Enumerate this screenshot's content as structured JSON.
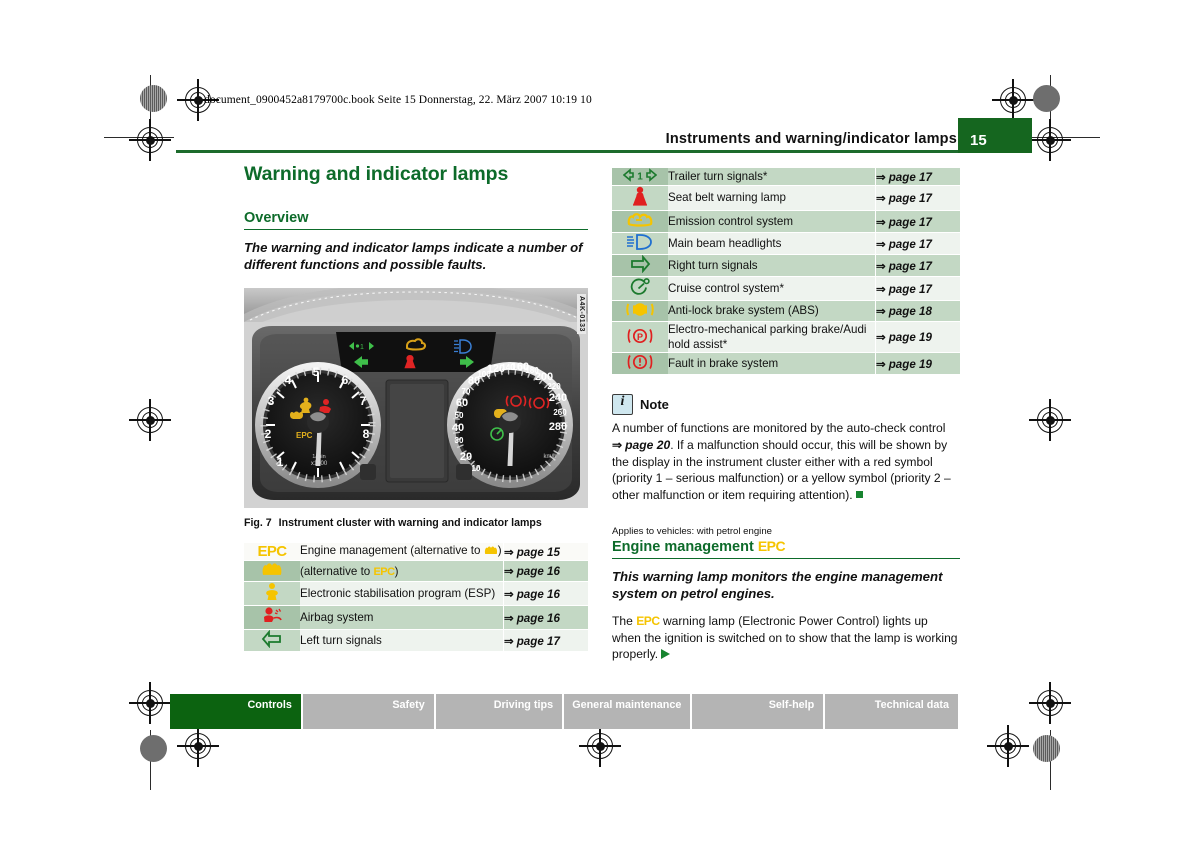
{
  "document_meta": "document_0900452a8179700c.book  Seite 15  Donnerstag, 22. März 2007  10:19 10",
  "header": {
    "title": "Instruments and warning/indicator lamps",
    "page_number": "15",
    "accent_color": "#15661f"
  },
  "left_column": {
    "chapter_title": "Warning and indicator lamps",
    "section_title": "Overview",
    "lead": "The warning and indicator lamps indicate a number of different functions and possible faults.",
    "figure": {
      "code": "A4K-0133",
      "caption_label": "Fig. 7",
      "caption_text": "Instrument cluster with warning and indicator lamps",
      "tachometer": {
        "ticks": [
          "1",
          "2",
          "3",
          "4",
          "5",
          "6",
          "7",
          "8"
        ],
        "unit": "1/min x1000"
      },
      "speedometer": {
        "ticks": [
          "10",
          "20",
          "30",
          "40",
          "50",
          "60",
          "70",
          "80",
          "100",
          "120",
          "140",
          "160",
          "180",
          "200",
          "220",
          "240",
          "260",
          "280"
        ],
        "unit": "km/h"
      }
    },
    "table_rows": [
      {
        "icon": "epc-lamp",
        "icon_color": "#f5c400",
        "desc_pre": "Engine management (alternative to ",
        "desc_post": ")",
        "desc_inline_icon": "glow-plug-lamp",
        "ref": "page 15",
        "shade": "white"
      },
      {
        "icon": "glow-plug-lamp",
        "icon_color": "#f5c400",
        "desc_pre": "(alternative to ",
        "desc_post": ")",
        "desc_inline_icon": "epc-lamp",
        "ref": "page 16",
        "shade": "shade"
      },
      {
        "icon": "esp-lamp",
        "icon_color": "#f5c400",
        "desc": "Electronic stabilisation program (ESP)",
        "ref": "page 16",
        "shade": "plain"
      },
      {
        "icon": "airbag-lamp",
        "icon_color": "#e02020",
        "desc": "Airbag system",
        "ref": "page 16",
        "shade": "shade"
      },
      {
        "icon": "left-turn-signal-lamp",
        "icon_color": "#1c7a2e",
        "desc": "Left turn signals",
        "ref": "page 17",
        "shade": "plain"
      }
    ]
  },
  "right_column": {
    "table_rows": [
      {
        "icon": "trailer-turn-signal-lamp",
        "icon_color": "#1c7a2e",
        "desc": "Trailer turn signals*",
        "ref": "page 17",
        "shade": "shade"
      },
      {
        "icon": "seat-belt-warning-lamp",
        "icon_color": "#e02020",
        "desc": "Seat belt warning lamp",
        "ref": "page 17",
        "shade": "plain"
      },
      {
        "icon": "emission-control-lamp",
        "icon_color": "#f5c400",
        "desc": "Emission control system",
        "ref": "page 17",
        "shade": "shade"
      },
      {
        "icon": "main-beam-headlight-lamp",
        "icon_color": "#1f6fd0",
        "desc": "Main beam headlights",
        "ref": "page 17",
        "shade": "plain"
      },
      {
        "icon": "right-turn-signal-lamp",
        "icon_color": "#1c7a2e",
        "desc": "Right turn signals",
        "ref": "page 17",
        "shade": "shade"
      },
      {
        "icon": "cruise-control-lamp",
        "icon_color": "#1c7a2e",
        "desc": "Cruise control system*",
        "ref": "page 17",
        "shade": "plain"
      },
      {
        "icon": "abs-lamp",
        "icon_color": "#f5c400",
        "desc": "Anti-lock brake system (ABS)",
        "ref": "page 18",
        "shade": "shade"
      },
      {
        "icon": "parking-brake-lamp",
        "icon_color": "#e02020",
        "desc": "Electro-mechanical parking brake/Audi hold assist*",
        "ref": "page 19",
        "shade": "plain"
      },
      {
        "icon": "brake-fault-lamp",
        "icon_color": "#e02020",
        "desc": "Fault in brake system",
        "ref": "page 19",
        "shade": "shade"
      }
    ],
    "note": {
      "title": "Note",
      "body_1": "A number of functions are monitored by the auto-check control ",
      "reference": "page 20",
      "body_2": ". If a malfunction should occur, this will be shown by the display in the instrument cluster either with a red symbol (priority 1 – serious malfunction) or a yellow symbol (priority 2 – other malfunction or item requiring attention)."
    },
    "applies_to": "Applies to vehicles: with petrol engine",
    "subsection_title": "Engine management",
    "subsection_title_icon": "EPC",
    "subsection_lead": "This warning lamp monitors the engine management system on petrol engines.",
    "body_pre": "The ",
    "body_icon": "EPC",
    "body_post": " warning lamp (Electronic Power Control) lights up when the ignition is switched on to show that the lamp is working properly."
  },
  "footer_nav": {
    "tabs": [
      {
        "label": "Controls",
        "active": true
      },
      {
        "label": "Safety",
        "active": false
      },
      {
        "label": "Driving tips",
        "active": false
      },
      {
        "label": "General maintenance",
        "active": false
      },
      {
        "label": "Self-help",
        "active": false
      },
      {
        "label": "Technical data",
        "active": false
      }
    ]
  }
}
